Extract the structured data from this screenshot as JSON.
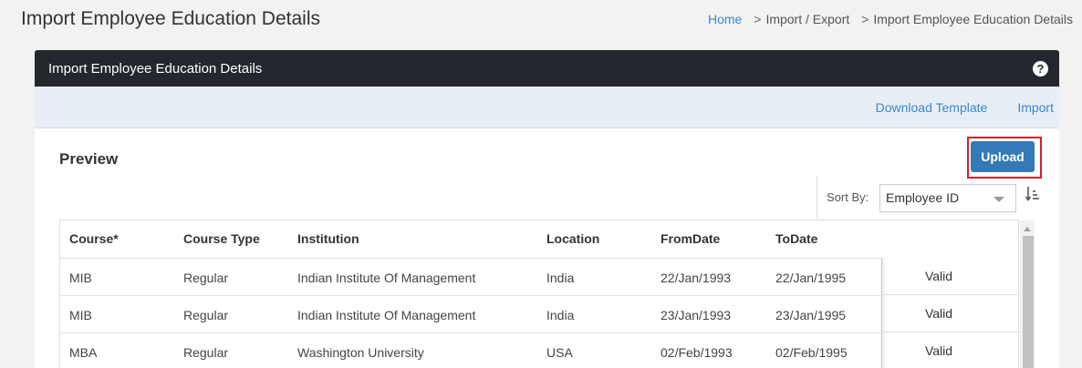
{
  "page": {
    "title": "Import Employee Education Details"
  },
  "breadcrumb": {
    "home": "Home",
    "import_export": "Import / Export",
    "current": "Import Employee Education Details",
    "separator": ">"
  },
  "panel": {
    "title": "Import Employee Education Details",
    "help_icon": "?"
  },
  "actions": {
    "download_template": "Download Template",
    "import": "Import"
  },
  "preview": {
    "title": "Preview",
    "upload_label": "Upload"
  },
  "sort": {
    "label": "Sort By:",
    "selected": "Employee ID"
  },
  "table": {
    "columns": [
      "Course*",
      "Course Type",
      "Institution",
      "Location",
      "FromDate",
      "ToDate"
    ],
    "rows": [
      {
        "course": "MIB",
        "course_type": "Regular",
        "institution": "Indian Institute Of Management",
        "location": "India",
        "from": "22/Jan/1993",
        "to": "22/Jan/1995",
        "status": "Valid"
      },
      {
        "course": "MIB",
        "course_type": "Regular",
        "institution": "Indian Institute Of Management",
        "location": "India",
        "from": "23/Jan/1993",
        "to": "23/Jan/1995",
        "status": "Valid"
      },
      {
        "course": "MBA",
        "course_type": "Regular",
        "institution": "Washington University",
        "location": "USA",
        "from": "02/Feb/1993",
        "to": "02/Feb/1995",
        "status": "Valid"
      }
    ]
  },
  "colors": {
    "header_bg": "#23282e",
    "link": "#3a87c8",
    "upload_bg": "#337ab7",
    "highlight": "#d6202b"
  }
}
